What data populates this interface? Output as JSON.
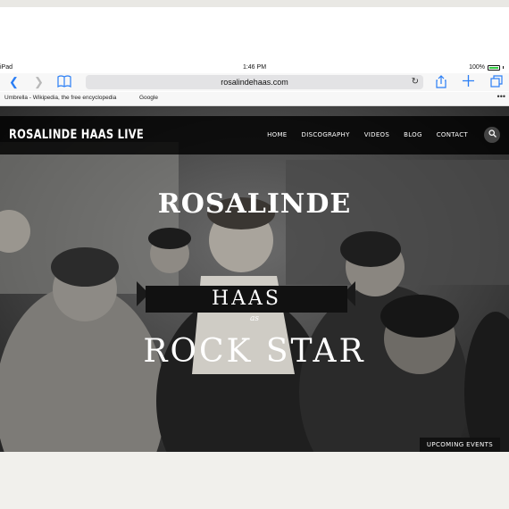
{
  "status": {
    "device": "iPad",
    "time": "1:46 PM",
    "battery": "100%"
  },
  "toolbar": {
    "back_icon": "chevron-left-icon",
    "forward_icon": "chevron-right-icon",
    "bookmarks_icon": "book-icon",
    "url": "rosalindehaas.com",
    "reload_icon": "reload-icon",
    "share_icon": "share-icon",
    "new_tab_icon": "plus-icon",
    "tabs_icon": "tabs-icon"
  },
  "bookmarks": {
    "items": [
      "Umbrella - Wikipedia, the free encyclopedia",
      "Google"
    ],
    "more_icon": "more-icon"
  },
  "site": {
    "brand": "ROSALINDE HAAS LIVE",
    "menu": [
      "HOME",
      "DISCOGRAPHY",
      "VIDEOS",
      "BLOG",
      "CONTACT"
    ],
    "search_icon": "search-icon",
    "hero": {
      "line1": "ROSALINDE",
      "line2": "HAAS",
      "line_as": "as",
      "line3": "ROCK STAR"
    },
    "upcoming": "UPCOMING EVENTS"
  },
  "colors": {
    "accent": "#2a7ef5",
    "nav_bg": "#000000",
    "text": "#ffffff"
  }
}
